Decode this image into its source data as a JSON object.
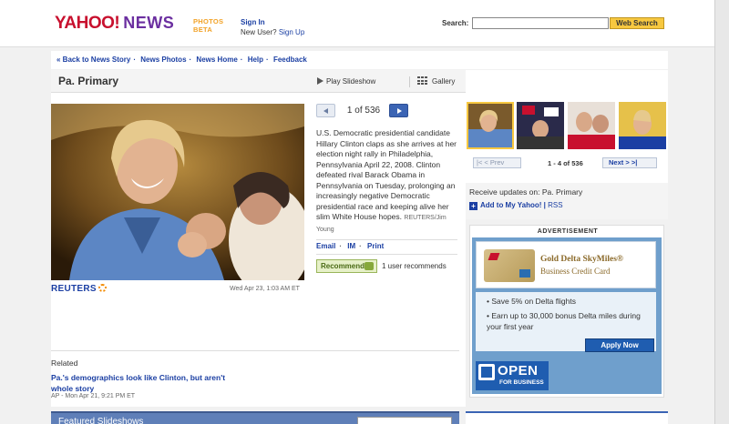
{
  "header": {
    "logo_yahoo": "YAHOO!",
    "logo_news": "NEWS",
    "photos_line1": "PHOTOS",
    "photos_line2": "BETA",
    "sign_in": "Sign In",
    "new_user": "New User?",
    "sign_up": "Sign Up",
    "search_label": "Search:",
    "search_value": "",
    "search_button": "Web Search"
  },
  "nav": {
    "items": [
      "« Back to News Story",
      "News Photos",
      "News Home",
      "Help",
      "Feedback"
    ]
  },
  "slideshow": {
    "title": "Pa. Primary",
    "play_label": "Play Slideshow",
    "gallery_label": "Gallery",
    "counter": "1 of 536",
    "caption": "U.S. Democratic presidential candidate Hillary Clinton claps as she arrives at her election night rally in Philadelphia, Pennsylvania April 22, 2008. Clinton defeated rival Barack Obama in Pennsylvania on Tuesday, prolonging an increasingly negative Democratic presidential race and keeping alive her slim White House hopes.",
    "credit": "REUTERS/Jim Young",
    "source_logo": "REUTERS",
    "date": "Wed Apr 23, 1:03 AM ET",
    "share_email": "Email",
    "share_im": "IM",
    "share_print": "Print",
    "recommend_button": "Recommend",
    "recommend_count": "1 user recommends"
  },
  "related": {
    "heading": "Related",
    "link": "Pa.'s demographics look like Clinton, but aren't whole story",
    "meta": "AP - Mon Apr 21, 9:21 PM ET"
  },
  "featured": {
    "title": "Featured Slideshows"
  },
  "thumbnails": {
    "prev": "Prev",
    "range": "1 - 4 of 536",
    "next": "Next"
  },
  "updates": {
    "heading": "Receive updates on: Pa. Primary",
    "add_link": "Add to My Yahoo!",
    "rss": "RSS"
  },
  "ad": {
    "label": "ADVERTISEMENT",
    "title": "Gold Delta SkyMiles®",
    "subtitle": "Business Credit Card",
    "bullet1": "Save 5% on Delta flights",
    "bullet2": "Earn up to 30,000 bonus Delta miles during your first year",
    "apply_button": "Apply Now",
    "open": "OPEN",
    "for_business": "FOR BUSINESS"
  },
  "colors": {
    "link": "#1b3fa3",
    "yahoo_red": "#c8102e",
    "news_purple": "#6b2fa0",
    "search_button": "#f7c840"
  }
}
